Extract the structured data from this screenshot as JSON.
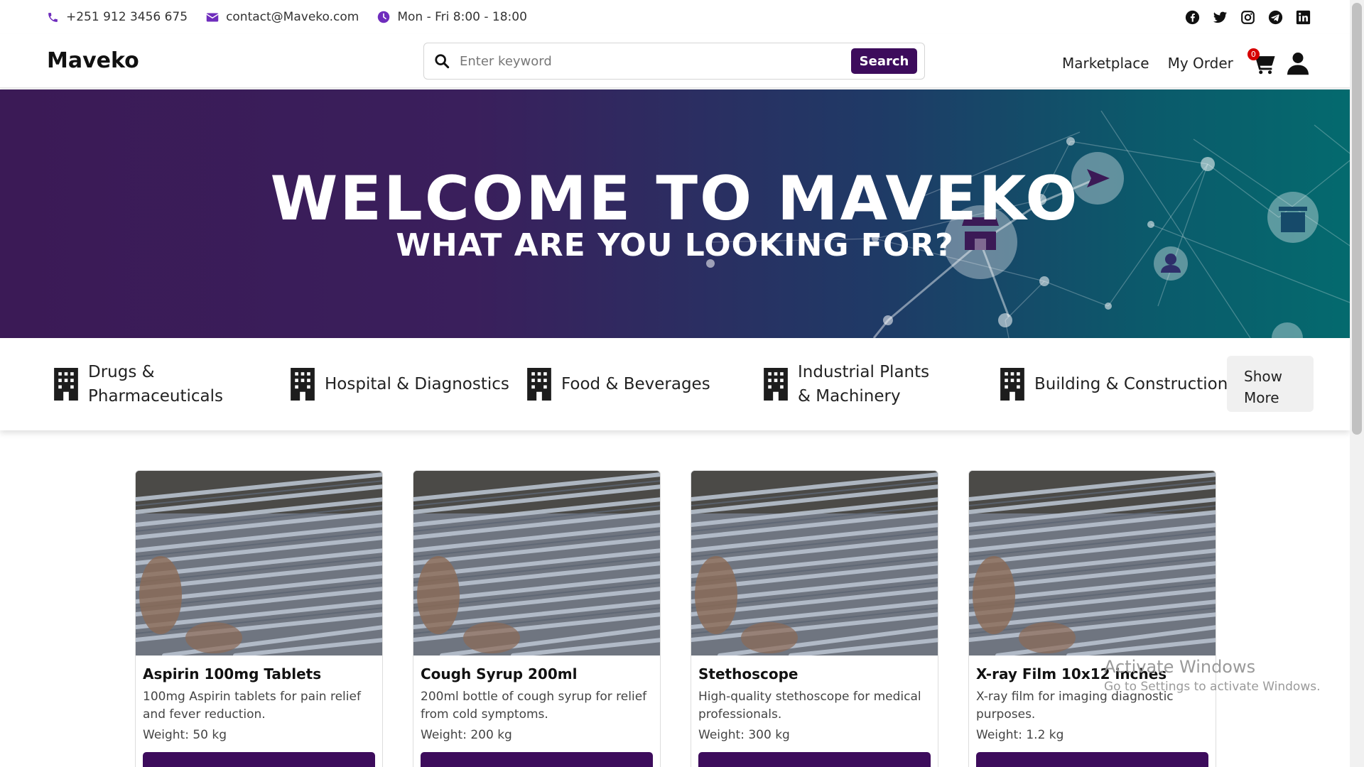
{
  "topbar": {
    "phone": "+251 912 3456 675",
    "email": "contact@Maveko.com",
    "hours": "Mon - Fri 8:00 - 18:00",
    "social": [
      "facebook-icon",
      "twitter-icon",
      "instagram-icon",
      "telegram-icon",
      "linkedin-icon"
    ]
  },
  "header": {
    "brand": "Maveko",
    "search_placeholder": "Enter keyword",
    "search_button": "Search",
    "nav": {
      "marketplace": "Marketplace",
      "my_order": "My Order"
    },
    "cart_count": "0"
  },
  "hero": {
    "title": "WELCOME TO MAVEKO",
    "subtitle": "WHAT ARE YOU LOOKING FOR?"
  },
  "categories": {
    "items": [
      {
        "label": "Drugs & Pharmaceuticals"
      },
      {
        "label": "Hospital & Diagnostics"
      },
      {
        "label": "Food & Beverages"
      },
      {
        "label": "Industrial Plants & Machinery"
      },
      {
        "label": "Building & Construction"
      }
    ],
    "show_more": "Show More"
  },
  "products": [
    {
      "title": "Aspirin 100mg Tablets",
      "desc": "100mg Aspirin tablets for pain relief and fever reduction.",
      "weight": "Weight: 50 kg"
    },
    {
      "title": "Cough Syrup 200ml",
      "desc": "200ml bottle of cough syrup for relief from cold symptoms.",
      "weight": "Weight: 200 kg"
    },
    {
      "title": "Stethoscope",
      "desc": "High-quality stethoscope for medical professionals.",
      "weight": "Weight: 300 kg"
    },
    {
      "title": "X-ray Film 10x12 inches",
      "desc": "X-ray film for imaging diagnostic purposes.",
      "weight": "Weight: 1.2 kg"
    }
  ],
  "watermark": {
    "title": "Activate Windows",
    "sub": "Go to Settings to activate Windows."
  },
  "colors": {
    "primary": "#3d0c5c",
    "accent_icon": "#6f2dbd",
    "badge": "#d60000"
  }
}
